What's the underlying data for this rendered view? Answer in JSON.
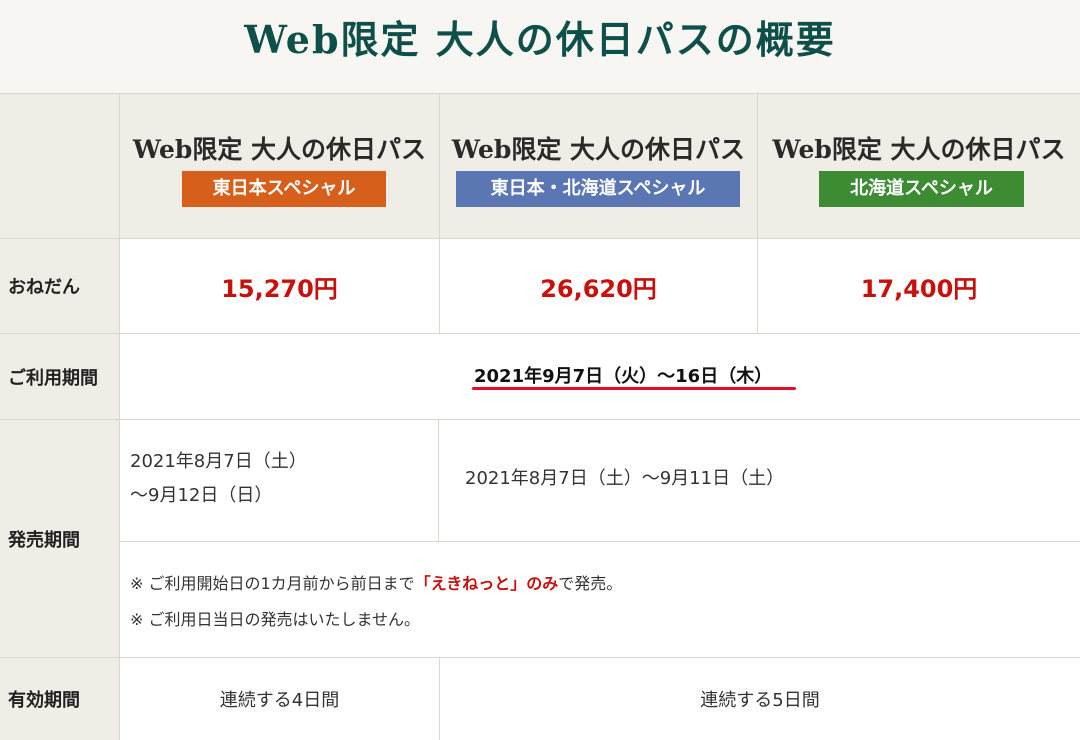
{
  "page_title": "Web限定 大人の休日パスの概要",
  "plans": [
    {
      "name": "Web限定 大人の休日パス",
      "badge": "東日本スペシャル",
      "badge_color": "#d65f1b",
      "price": "15,270円",
      "valid": "連続する4日間"
    },
    {
      "name": "Web限定 大人の休日パス",
      "badge": "東日本・北海道スペシャル",
      "badge_color": "#5a77b4",
      "price": "26,620円"
    },
    {
      "name": "Web限定 大人の休日パス",
      "badge": "北海道スペシャル",
      "badge_color": "#3d8c34",
      "price": "17,400円"
    }
  ],
  "rows": {
    "price": "おねだん",
    "usage_period": "ご利用期間",
    "sales_period": "発売期間",
    "valid_period": "有効期間"
  },
  "usage_period_value": "2021年9月7日（火）～16日（木）",
  "sales": {
    "east_line1": "2021年8月7日（土）",
    "east_line2": "～9月12日（日）",
    "others": "2021年8月7日（土）～9月11日（土）"
  },
  "notes": {
    "note1_prefix": "※ ご利用開始日の1カ月前から前日まで",
    "note1_highlight": "「えきねっと」のみ",
    "note1_suffix": "で発売。",
    "note2": "※ ご利用日当日の発売はいたしません。"
  },
  "valid_others": "連続する5日間",
  "colors": {
    "title": "#0f4f4a",
    "price": "#c8100c",
    "underline": "#e0102a",
    "header_bg": "#efede5"
  }
}
